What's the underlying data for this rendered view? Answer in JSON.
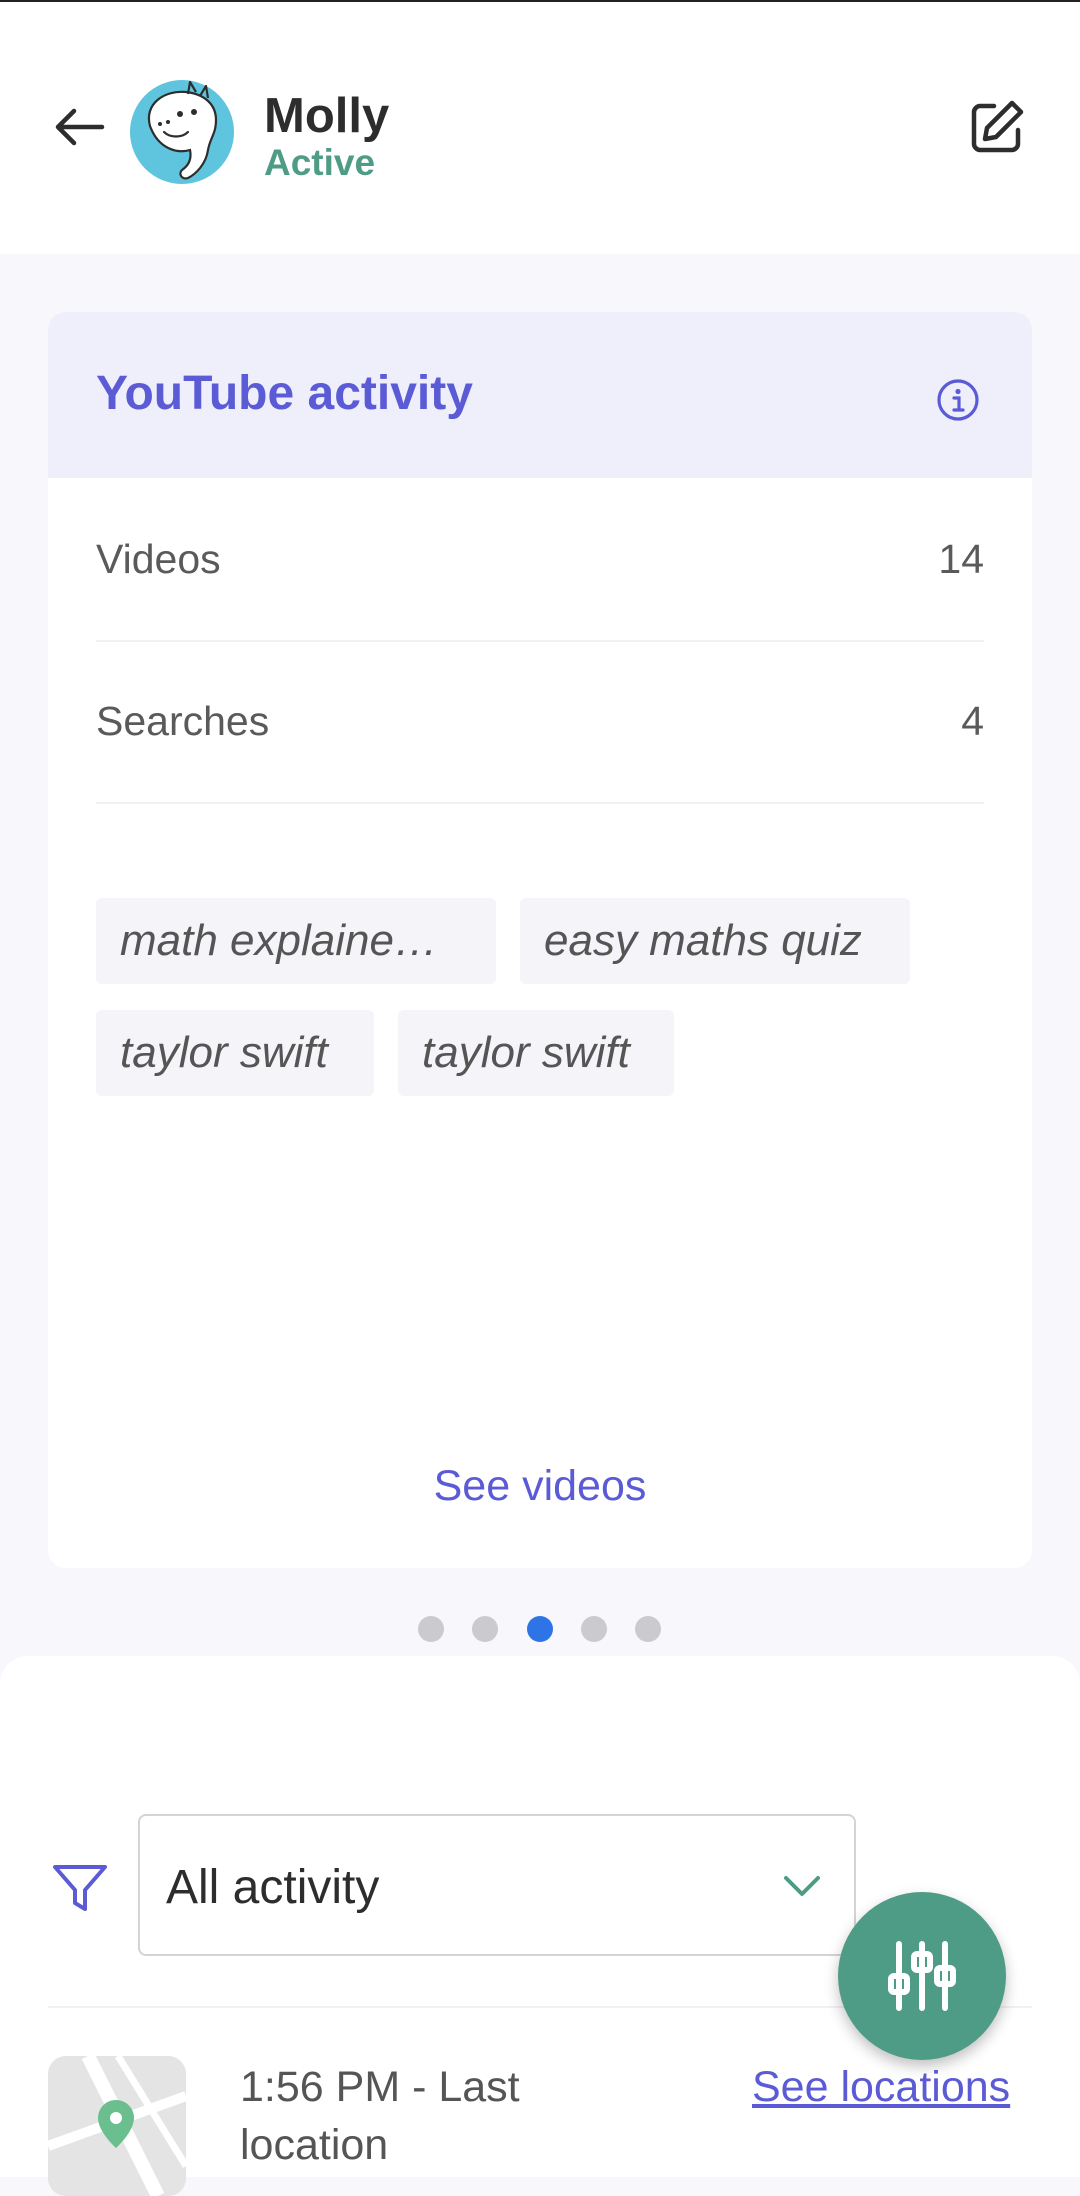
{
  "profile": {
    "name": "Molly",
    "status": "Active"
  },
  "card": {
    "title": "YouTube activity",
    "stats": [
      {
        "label": "Videos",
        "value": "14"
      },
      {
        "label": "Searches",
        "value": "4"
      }
    ],
    "searches": [
      "math explaine…",
      "easy maths quiz",
      "taylor swift",
      "taylor swift"
    ],
    "cta": "See videos"
  },
  "pager": {
    "count": 5,
    "active_index": 2
  },
  "filter": {
    "selected": "All activity"
  },
  "activity": {
    "location_text": "1:56 PM - Last location",
    "see_locations": "See locations"
  },
  "colors": {
    "accent": "#5B5BD6",
    "green": "#4F9C86",
    "dot_active": "#2F74E6"
  }
}
